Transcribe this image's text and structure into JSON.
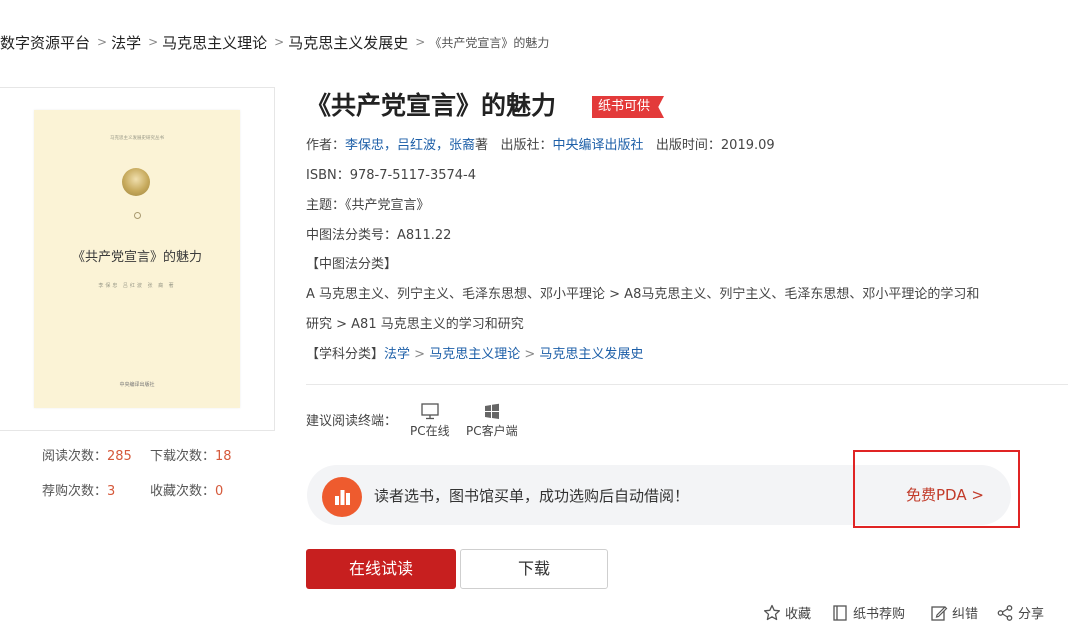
{
  "breadcrumb": {
    "items": [
      "数字资源平台",
      "法学",
      "马克思主义理论",
      "马克思主义发展史"
    ],
    "current": "《共产党宣言》的魅力",
    "sep": ">"
  },
  "book": {
    "title": "《共产党宣言》的魅力",
    "badge": "纸书可供",
    "cover": {
      "series_line": "马克思主义发展史研究丛书",
      "title": "《共产党宣言》的魅力",
      "authors": "李保忠  吕红波  张 裔  著",
      "publisher": "中央编译出版社"
    },
    "author_label": "作者：",
    "authors": "李保忠，吕红波，张裔",
    "authors_suffix": "著",
    "publisher_label": "出版社：",
    "publisher": "中央编译出版社",
    "pubdate_label": "出版时间：",
    "pubdate": "2019.09",
    "isbn_label": "ISBN：",
    "isbn": "978-7-5117-3574-4",
    "subject_label": "主题：",
    "subject": "《共产党宣言》",
    "clc_label": "中图法分类号：",
    "clc": "A811.22",
    "clc_cat_label": "【中图法分类】",
    "clc_path_line1": "A 马克思主义、列宁主义、毛泽东思想、邓小平理论 > A8马克思主义、列宁主义、毛泽东思想、邓小平理论的学习和",
    "clc_path_line2": "研究 > A81 马克思主义的学习和研究",
    "discipline_label": "【学科分类】",
    "discipline": [
      "法学",
      "马克思主义理论",
      "马克思主义发展史"
    ]
  },
  "stats": {
    "read_label": "阅读次数：",
    "read": "285",
    "download_label": "下载次数：",
    "download": "18",
    "recommend_label": "荐购次数：",
    "recommend": "3",
    "collect_label": "收藏次数：",
    "collect": "0"
  },
  "terminals": {
    "label": "建议阅读终端：",
    "items": [
      {
        "label": "PC在线",
        "icon": "monitor-icon"
      },
      {
        "label": "PC客户端",
        "icon": "windows-icon"
      }
    ]
  },
  "banner": {
    "text": "读者选书，图书馆买单，成功选购后自动借阅！",
    "link": "免费PDA >",
    "icon": "bar-chart-icon",
    "accent": "#ee5b2e"
  },
  "buttons": {
    "read": "在线试读",
    "download": "下载"
  },
  "actions": [
    {
      "label": "收藏",
      "icon": "star-icon"
    },
    {
      "label": "纸书荐购",
      "icon": "book-icon"
    },
    {
      "label": "纠错",
      "icon": "edit-icon"
    },
    {
      "label": "分享",
      "icon": "share-icon"
    }
  ],
  "colors": {
    "primary_red": "#c71f1f",
    "link_blue": "#1d5fa8",
    "highlight_box": "#e02424",
    "count_orange": "#d5593b"
  }
}
